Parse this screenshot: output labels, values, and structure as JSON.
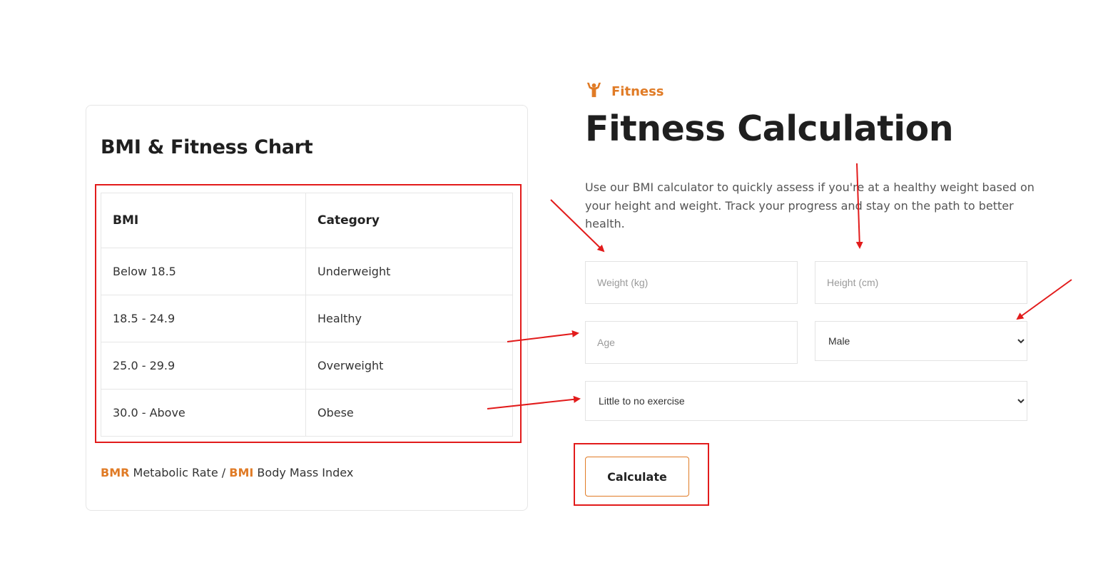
{
  "chart_card": {
    "title": "BMI & Fitness Chart",
    "columns": [
      "BMI",
      "Category"
    ],
    "rows": [
      [
        "Below 18.5",
        "Underweight"
      ],
      [
        "18.5 - 24.9",
        "Healthy"
      ],
      [
        "25.0 - 29.9",
        "Overweight"
      ],
      [
        "30.0 - Above",
        "Obese"
      ]
    ],
    "legend": {
      "bmr_abbr": "BMR",
      "bmr_text": "Metabolic Rate",
      "separator": "/",
      "bmi_abbr": "BMI",
      "bmi_text": "Body Mass Index"
    }
  },
  "header": {
    "eyebrow": "Fitness",
    "eyebrow_icon": "flexing-muscle-icon",
    "title": "Fitness Calculation",
    "description": "Use our BMI calculator to quickly assess if you're at a healthy weight based on your height and weight. Track your progress and stay on the path to better health."
  },
  "form": {
    "weight_placeholder": "Weight (kg)",
    "height_placeholder": "Height (cm)",
    "age_placeholder": "Age",
    "gender_selected": "Male",
    "activity_selected": "Little to no exercise",
    "submit_label": "Calculate"
  },
  "colors": {
    "accent": "#e07b26",
    "annotation": "#e21b1b",
    "border": "#e6e6e6"
  }
}
